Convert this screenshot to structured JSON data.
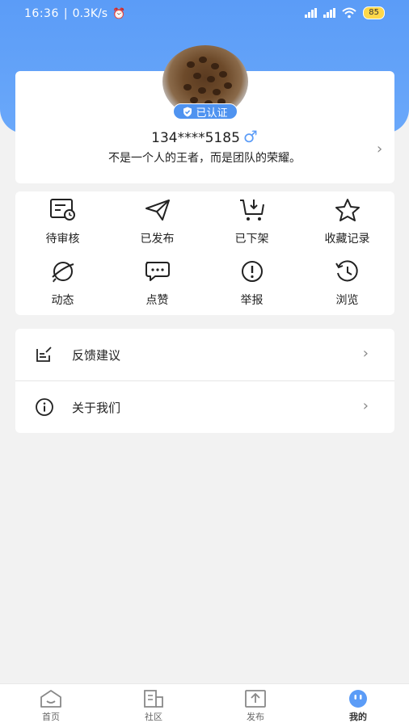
{
  "status_bar": {
    "time": "16:36",
    "network_speed": "0.3K/s",
    "battery": "85"
  },
  "profile": {
    "verified_label": "已认证",
    "phone": "134****5185",
    "gender_symbol": "♂",
    "motto": "不是一个人的王者，而是团队的荣耀。"
  },
  "grid": {
    "items": [
      {
        "label": "待审核",
        "icon": "pending-review-icon"
      },
      {
        "label": "已发布",
        "icon": "paper-plane-icon"
      },
      {
        "label": "已下架",
        "icon": "cart-download-icon"
      },
      {
        "label": "收藏记录",
        "icon": "star-icon"
      },
      {
        "label": "动态",
        "icon": "planet-icon"
      },
      {
        "label": "点赞",
        "icon": "chat-bubble-icon"
      },
      {
        "label": "举报",
        "icon": "exclamation-circle-icon"
      },
      {
        "label": "浏览",
        "icon": "history-icon"
      }
    ]
  },
  "menu": {
    "items": [
      {
        "label": "反馈建议",
        "icon": "edit-note-icon"
      },
      {
        "label": "关于我们",
        "icon": "info-circle-icon"
      }
    ]
  },
  "tabbar": {
    "items": [
      {
        "label": "首页",
        "icon": "home-icon",
        "active": false
      },
      {
        "label": "社区",
        "icon": "community-icon",
        "active": false
      },
      {
        "label": "发布",
        "icon": "upload-icon",
        "active": false
      },
      {
        "label": "我的",
        "icon": "smiley-face-icon",
        "active": true
      }
    ]
  },
  "colors": {
    "header_blue": "#5b9cf7",
    "verified_badge": "#4f93f0",
    "battery": "#ffd84a",
    "background": "#f2f2f2"
  }
}
